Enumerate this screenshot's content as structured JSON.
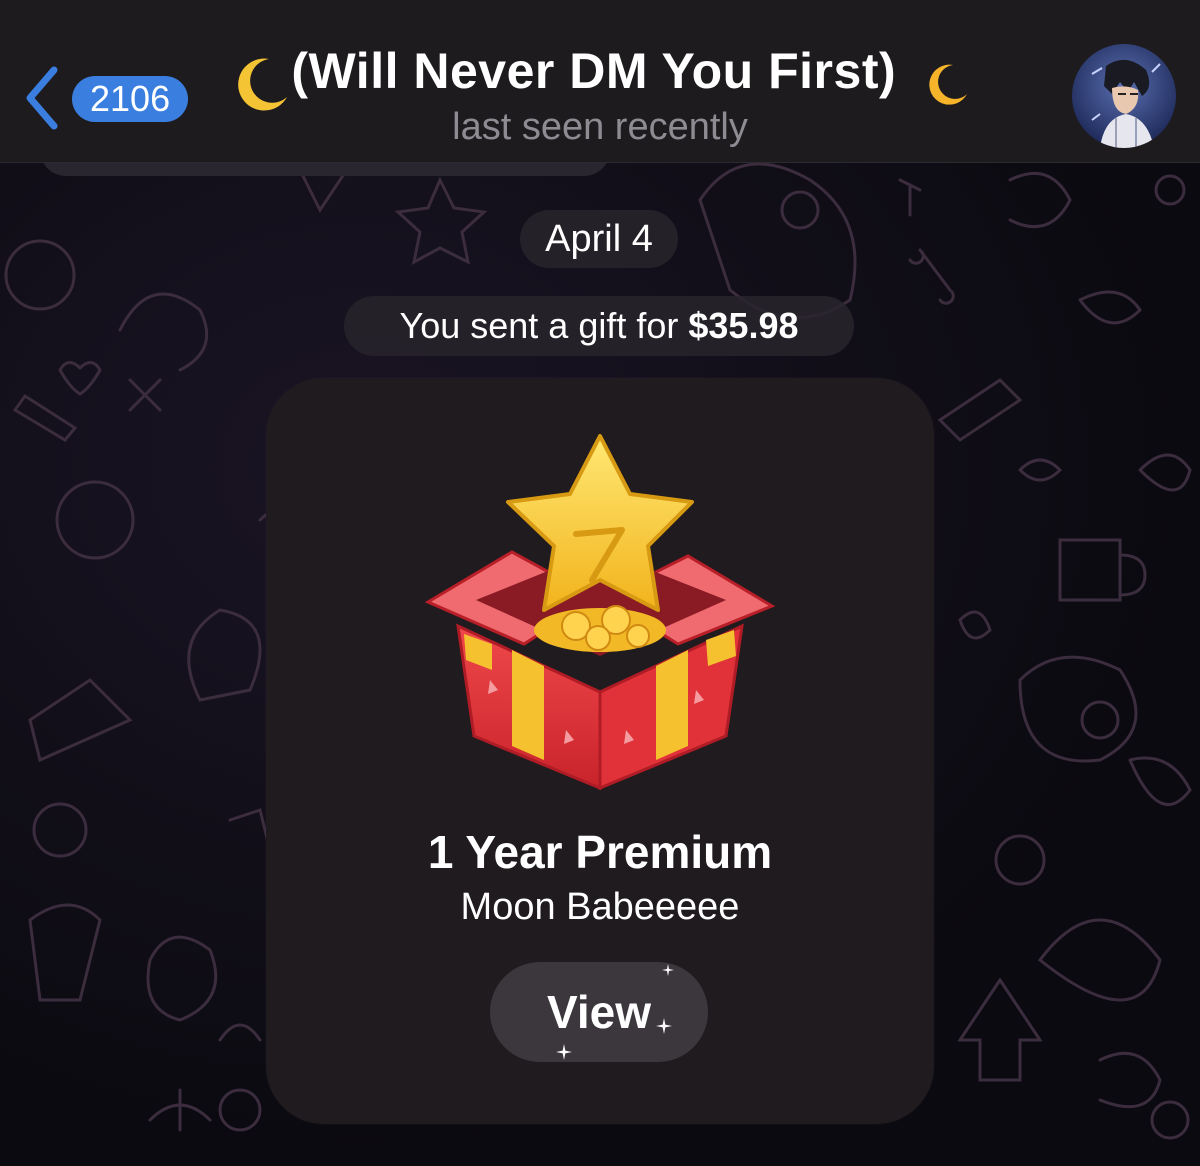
{
  "header": {
    "unread_count": "2106",
    "title": "(Will Never DM You First)",
    "status": "last seen recently"
  },
  "messages": {
    "date_label": "April 4",
    "gift_notice_prefix": "You sent a gift for",
    "gift_notice_amount": "$35.98"
  },
  "gift_card": {
    "title": "1 Year Premium",
    "recipient": "Moon Babeeeee",
    "button_label": "View"
  },
  "colors": {
    "accent": "#3a7fe0",
    "header_bg": "#1e1b1f",
    "card_bg": "#1f1b1e",
    "star": "#f7c42a",
    "box": "#e63a3e"
  },
  "icons": [
    "back-chevron-icon",
    "crescent-moon-icon",
    "avatar",
    "star-gift-box-icon",
    "sparkle-icon"
  ]
}
